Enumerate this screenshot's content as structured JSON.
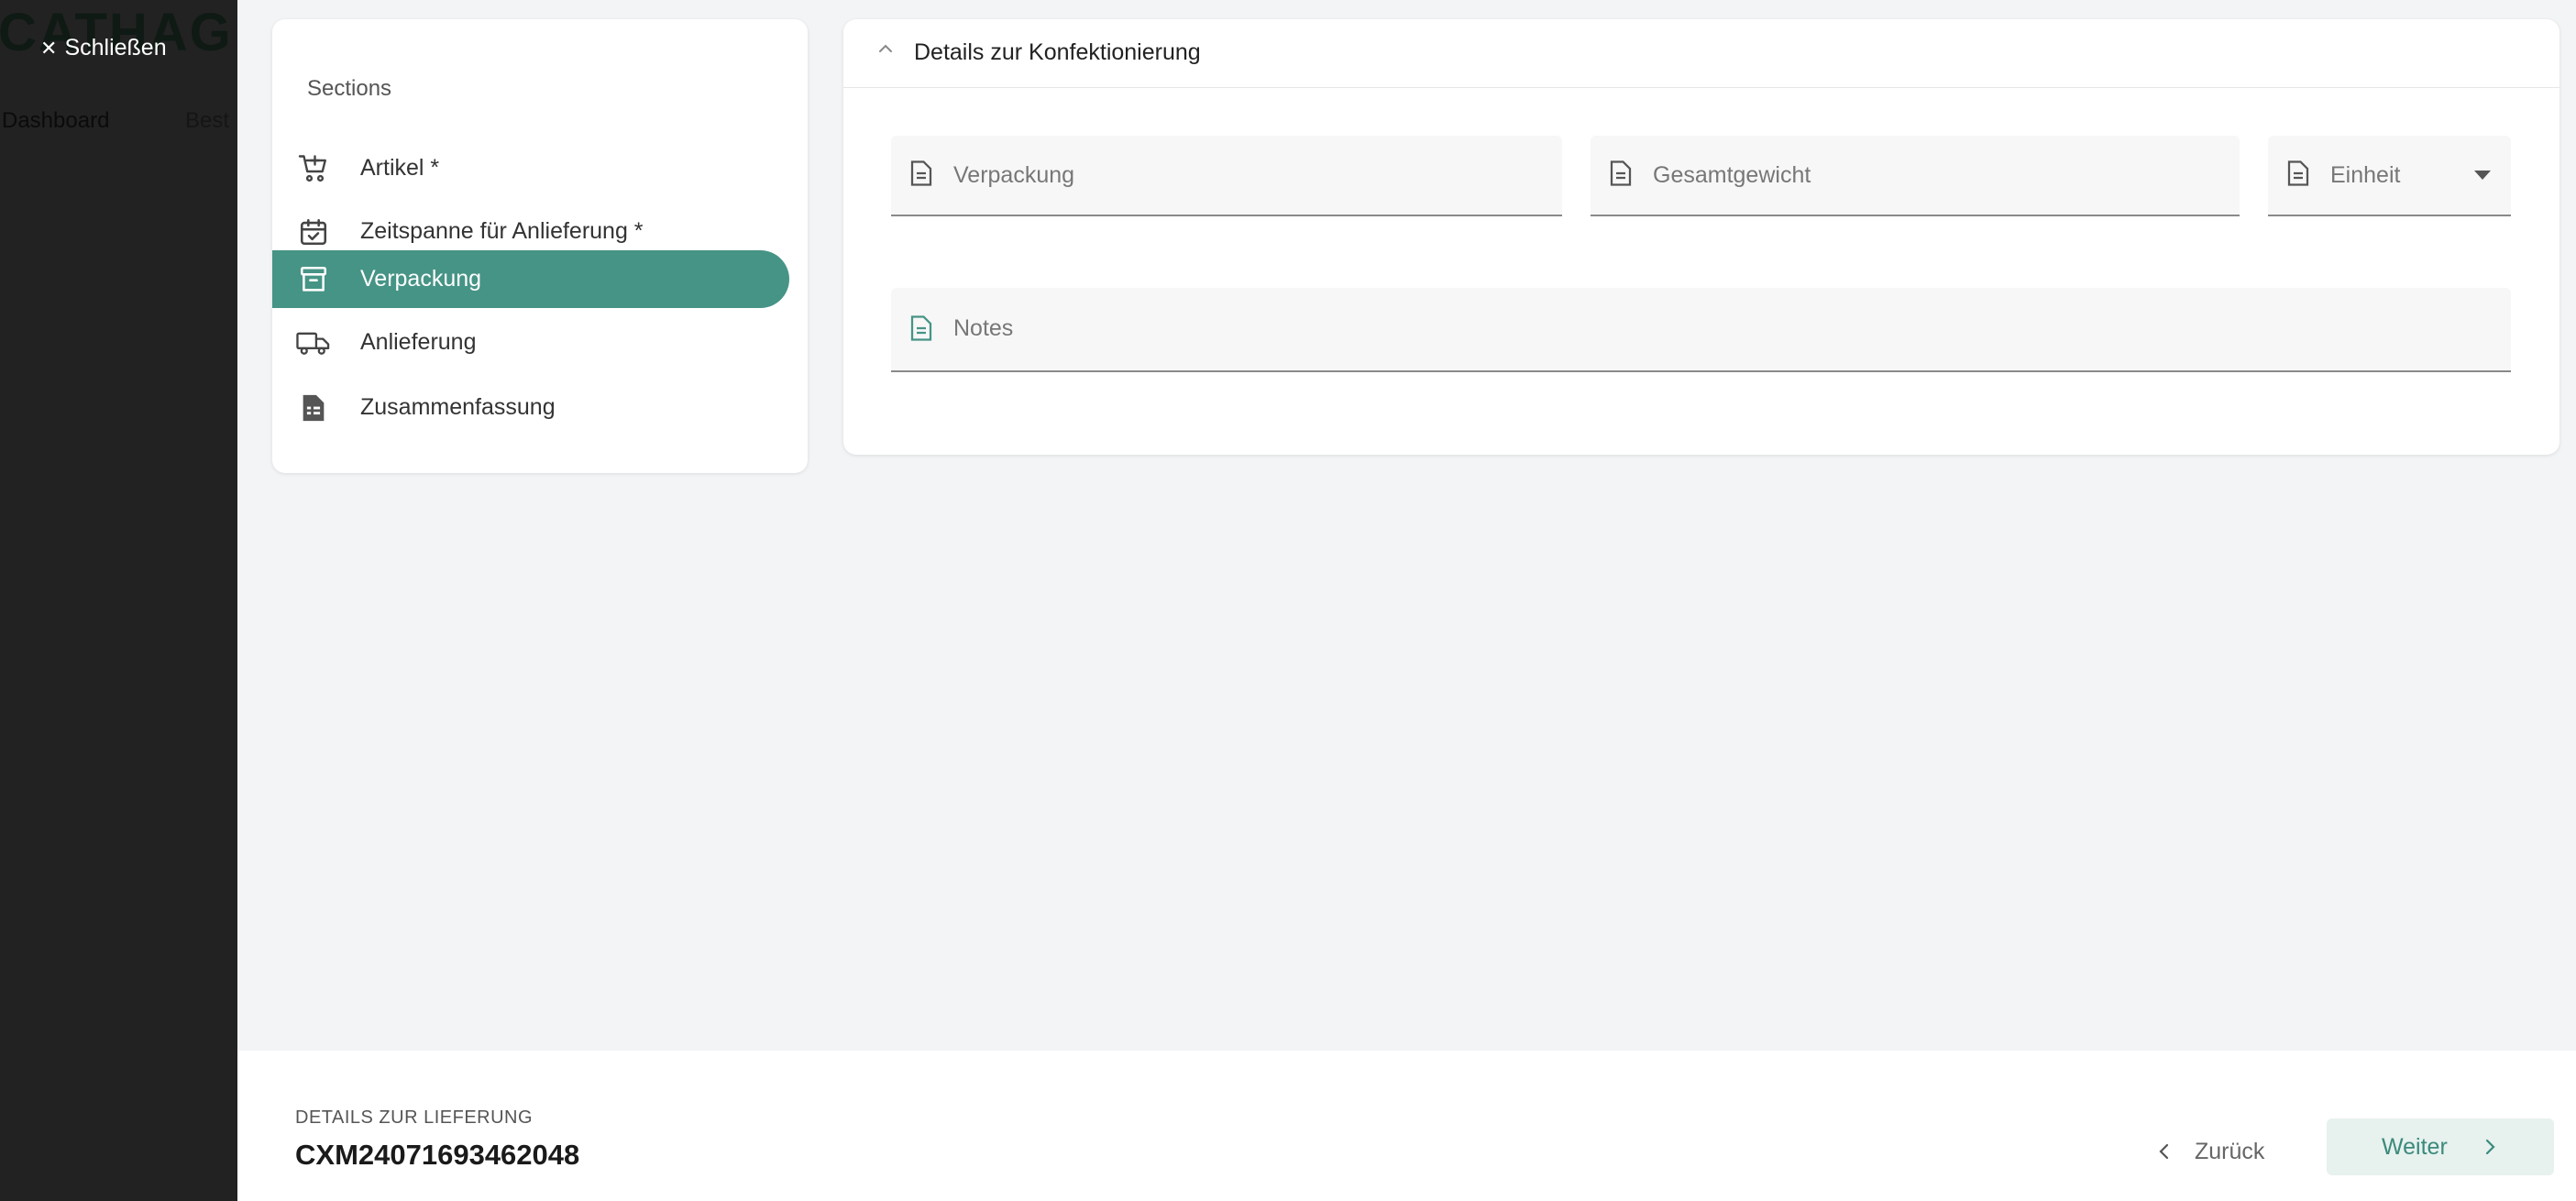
{
  "backdrop": {
    "logo_text": "CATHAG",
    "nav_items": [
      "Dashboard",
      "Best"
    ]
  },
  "close_label": "Schließen",
  "sections": {
    "title": "Sections",
    "items": [
      {
        "label": "Artikel *",
        "icon": "cart-add-icon"
      },
      {
        "label": "Zeitspanne für Anlieferung *",
        "icon": "calendar-check-icon"
      },
      {
        "label": "Verpackung",
        "icon": "archive-box-icon",
        "active": true
      },
      {
        "label": "Anlieferung",
        "icon": "truck-icon"
      },
      {
        "label": "Zusammenfassung",
        "icon": "document-icon"
      }
    ]
  },
  "details": {
    "title": "Details zur Konfektionierung",
    "fields": {
      "verpackung": {
        "placeholder": "Verpackung",
        "value": ""
      },
      "gesamtgewicht": {
        "placeholder": "Gesamtgewicht",
        "value": ""
      },
      "einheit": {
        "placeholder": "Einheit",
        "value": ""
      },
      "notes": {
        "placeholder": "Notes",
        "value": ""
      }
    }
  },
  "footer": {
    "subtitle": "DETAILS ZUR LIEFERUNG",
    "code": "CXM24071693462048",
    "back_label": "Zurück",
    "next_label": "Weiter"
  },
  "colors": {
    "accent": "#469486",
    "backdrop": "#222222",
    "background": "#f3f4f6",
    "next_button_bg": "#e7f1ee"
  }
}
